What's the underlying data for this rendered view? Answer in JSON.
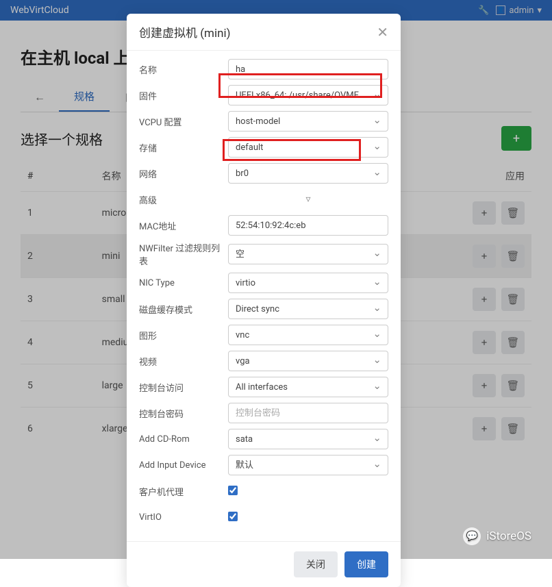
{
  "navbar": {
    "brand": "WebVirtCloud",
    "user_label": "admin",
    "user_caret": "▾"
  },
  "page": {
    "title": "在主机 local 上"
  },
  "tabs": {
    "back": "←",
    "spec": "规格",
    "custom": "自"
  },
  "section": {
    "title": "选择一个规格",
    "add": "+"
  },
  "table": {
    "headers": {
      "idx": "#",
      "name": "名称",
      "apply": "应用"
    },
    "rows": [
      {
        "idx": "1",
        "name": "micro"
      },
      {
        "idx": "2",
        "name": "mini"
      },
      {
        "idx": "3",
        "name": "small"
      },
      {
        "idx": "4",
        "name": "medium"
      },
      {
        "idx": "5",
        "name": "large"
      },
      {
        "idx": "6",
        "name": "xlarge"
      }
    ],
    "plus": "+",
    "trash": "🗑"
  },
  "modal": {
    "title": "创建虚拟机 (mini)",
    "close": "✕",
    "labels": {
      "name": "名称",
      "firmware": "固件",
      "vcpu": "VCPU 配置",
      "storage": "存储",
      "network": "网络",
      "advanced": "高级",
      "mac": "MAC地址",
      "nwfilter": "NWFilter 过滤规则列表",
      "nic": "NIC Type",
      "cache": "磁盘缓存模式",
      "graphics": "图形",
      "video": "视频",
      "console_access": "控制台访问",
      "console_pwd": "控制台密码",
      "cdrom": "Add CD-Rom",
      "input_dev": "Add Input Device",
      "guest_agent": "客户机代理",
      "virtio": "VirtIO"
    },
    "values": {
      "name": "ha",
      "firmware": "UEFI x86_64: /usr/share/OVMF",
      "vcpu": "host-model",
      "storage": "default",
      "network": "br0",
      "advanced_toggle": "▿",
      "mac": "52:54:10:92:4c:eb",
      "nwfilter": "空",
      "nic": "virtio",
      "cache": "Direct sync",
      "graphics": "vnc",
      "video": "vga",
      "console_access": "All interfaces",
      "console_pwd_placeholder": "控制台密码",
      "cdrom": "sata",
      "input_dev": "默认"
    },
    "footer": {
      "close": "关闭",
      "create": "创建"
    }
  },
  "watermark": {
    "text": "iStoreOS"
  }
}
